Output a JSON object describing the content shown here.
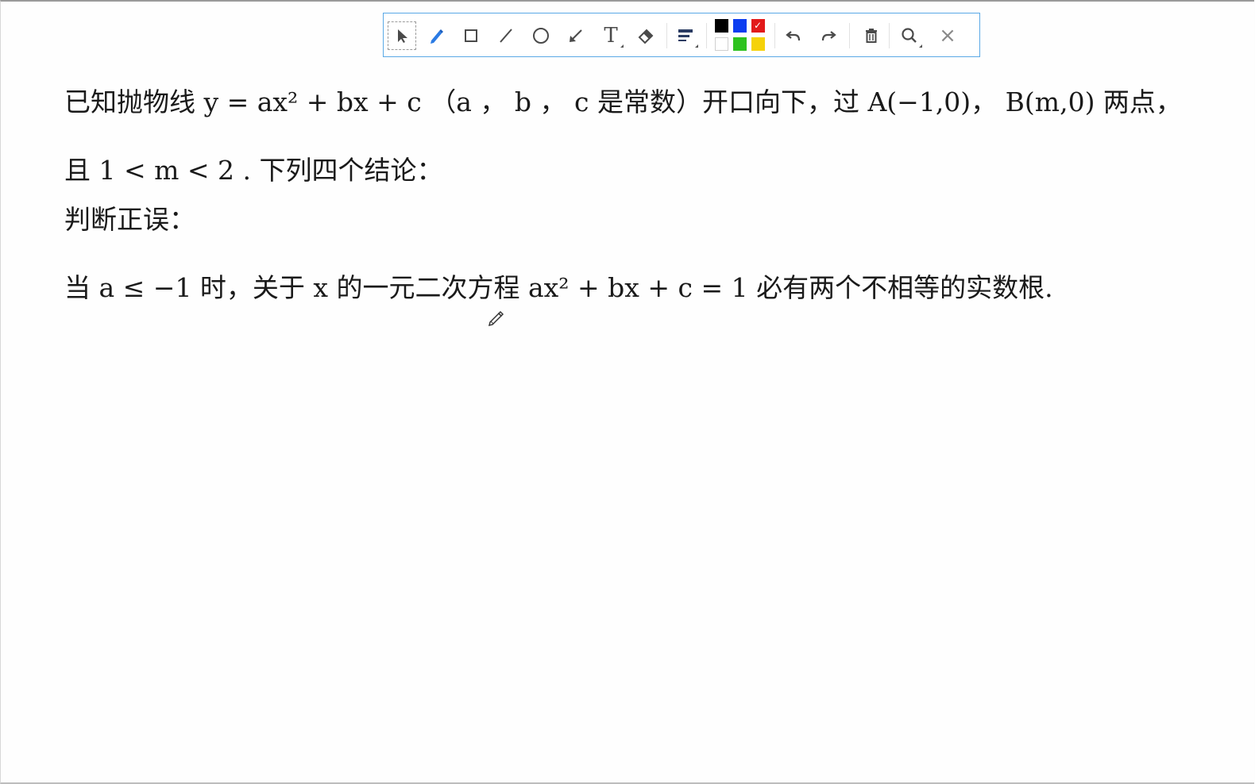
{
  "toolbar": {
    "tools": [
      {
        "name": "select",
        "icon": "cursor-arrow-icon"
      },
      {
        "name": "pen",
        "icon": "pen-icon"
      },
      {
        "name": "rectangle",
        "icon": "rectangle-icon"
      },
      {
        "name": "line",
        "icon": "line-icon"
      },
      {
        "name": "ellipse",
        "icon": "circle-icon"
      },
      {
        "name": "arrow",
        "icon": "arrow-icon"
      },
      {
        "name": "text",
        "icon": "text-icon",
        "glyph": "T"
      },
      {
        "name": "eraser",
        "icon": "eraser-icon"
      },
      {
        "name": "line-width",
        "icon": "line-width-icon"
      },
      {
        "name": "undo",
        "icon": "undo-icon"
      },
      {
        "name": "redo",
        "icon": "redo-icon"
      },
      {
        "name": "clear",
        "icon": "trash-icon"
      },
      {
        "name": "zoom",
        "icon": "search-icon"
      },
      {
        "name": "close",
        "icon": "close-icon",
        "glyph": "×"
      }
    ],
    "colors": {
      "top_row": [
        "#000000",
        "#0d3df0",
        "#e21a1a"
      ],
      "bottom_row": [
        "#ffffff",
        "#2ec21f",
        "#f5d20a"
      ],
      "selected": "#e21a1a"
    },
    "accent": "#5aa9e6"
  },
  "content": {
    "line1": "已知抛物线 y = ax² + bx + c （a ， b ， c 是常数）开口向下，过 A(−1,0)， B(m,0) 两点，",
    "line2": "且 1 < m < 2 . 下列四个结论：",
    "line3": "判断正误：",
    "line4": "当 a ≤ −1 时，关于 x 的一元二次方程 ax² + bx + c = 1 必有两个不相等的实数根."
  },
  "cursor": {
    "icon": "pencil-cursor-icon"
  }
}
